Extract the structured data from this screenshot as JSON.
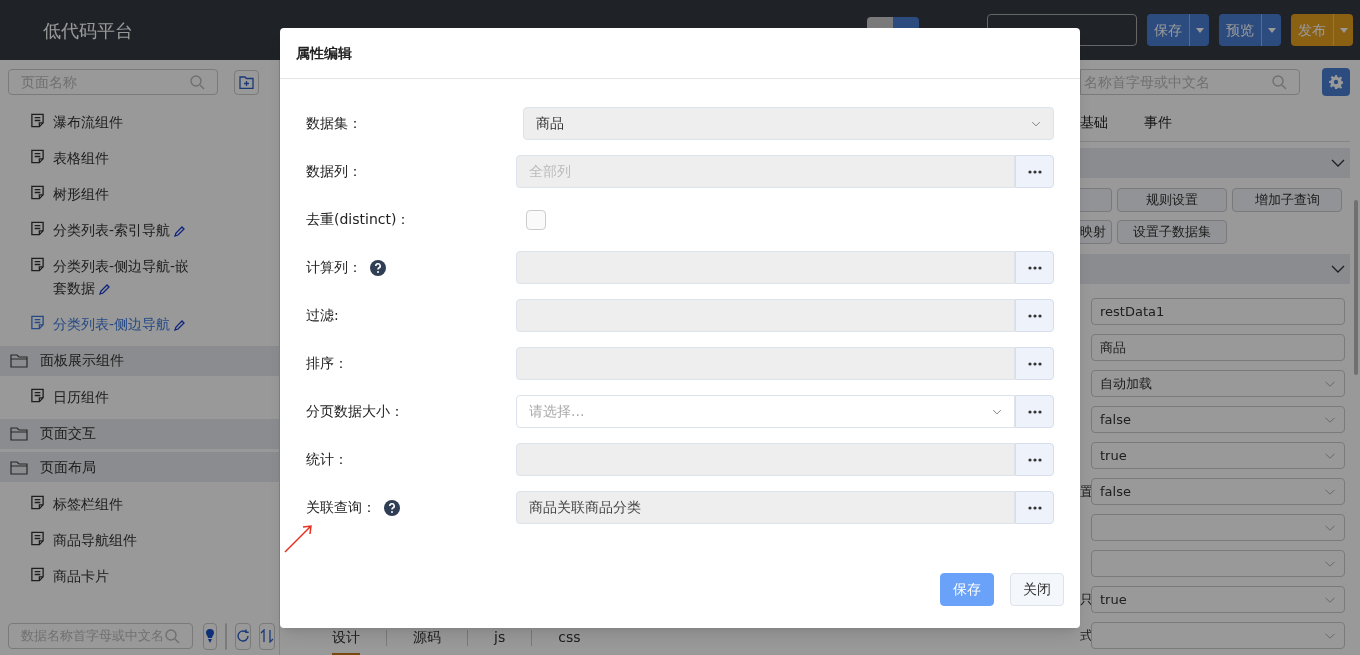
{
  "header": {
    "logo": "低代码平台",
    "actions": [
      {
        "label": "保存",
        "kind": "primary"
      },
      {
        "label": "预览",
        "kind": "primary"
      },
      {
        "label": "发布",
        "kind": "warning"
      }
    ]
  },
  "sidebar": {
    "search_placeholder": "页面名称",
    "items": [
      {
        "kind": "page",
        "label": "瀑布流组件",
        "editable": false,
        "selected": false
      },
      {
        "kind": "page",
        "label": "表格组件",
        "editable": false,
        "selected": false
      },
      {
        "kind": "page",
        "label": "树形组件",
        "editable": false,
        "selected": false
      },
      {
        "kind": "page",
        "label": "分类列表-索引导航",
        "editable": true,
        "selected": false
      },
      {
        "kind": "page",
        "label": "分类列表-侧边导航-嵌套数据",
        "editable": true,
        "selected": false
      },
      {
        "kind": "page",
        "label": "分类列表-侧边导航",
        "editable": true,
        "selected": true
      },
      {
        "kind": "folder",
        "label": "面板展示组件"
      },
      {
        "kind": "page",
        "label": "日历组件",
        "editable": false,
        "selected": false
      },
      {
        "kind": "folder",
        "label": "页面交互"
      },
      {
        "kind": "folder",
        "label": "页面布局"
      },
      {
        "kind": "page",
        "label": "标签栏组件",
        "editable": false,
        "selected": false
      },
      {
        "kind": "page",
        "label": "商品导航组件",
        "editable": false,
        "selected": false
      },
      {
        "kind": "page",
        "label": "商品卡片",
        "editable": false,
        "selected": false
      }
    ],
    "data_search_placeholder": "数据名称首字母或中文名"
  },
  "editor_tabs": [
    {
      "label": "设计",
      "selected": true
    },
    {
      "label": "源码",
      "selected": false
    },
    {
      "label": "js",
      "selected": false
    },
    {
      "label": "css",
      "selected": false
    }
  ],
  "inspector": {
    "search_placeholder": "名称首字母或中文名",
    "tabs": [
      {
        "label": "基础",
        "selected": false
      },
      {
        "label": "事件",
        "selected": false
      }
    ],
    "buttons": [
      [
        {
          "kind": "clipped"
        },
        {
          "kind": "full",
          "label": "规则设置"
        },
        {
          "kind": "full",
          "label": "增加子查询"
        }
      ],
      [
        {
          "kind": "clipped",
          "label": "映射"
        },
        {
          "kind": "full",
          "label": "设置子数据集"
        }
      ]
    ],
    "fields": [
      {
        "kind": "input",
        "value": "restData1"
      },
      {
        "kind": "input",
        "value": "商品"
      },
      {
        "kind": "select",
        "value": "自动加载"
      },
      {
        "kind": "select",
        "value": "false"
      },
      {
        "kind": "select",
        "value": "true"
      },
      {
        "kind": "select",
        "label": "置",
        "value": "false"
      },
      {
        "kind": "select"
      },
      {
        "kind": "select"
      },
      {
        "kind": "select",
        "label": "只",
        "value": "true"
      },
      {
        "kind": "select",
        "label": "式"
      }
    ]
  },
  "dialog": {
    "title": "属性编辑",
    "rows": [
      {
        "kind": "select",
        "label": "数据集：",
        "value": "商品"
      },
      {
        "kind": "picker",
        "label": "数据列：",
        "placeholder": "全部列"
      },
      {
        "kind": "checkbox",
        "label": "去重(distinct)：",
        "checked": false
      },
      {
        "kind": "picker",
        "label": "计算列：",
        "help": true
      },
      {
        "kind": "picker",
        "label": "过滤:"
      },
      {
        "kind": "picker",
        "label": "排序："
      },
      {
        "kind": "select-picker",
        "label": "分页数据大小：",
        "placeholder": "请选择..."
      },
      {
        "kind": "picker",
        "label": "统计："
      },
      {
        "kind": "picker",
        "label": "关联查询：",
        "help": true,
        "value": "商品关联商品分类"
      }
    ],
    "buttons": [
      {
        "kind": "primary",
        "label": "保存"
      },
      {
        "kind": "default",
        "label": "关闭"
      }
    ]
  }
}
